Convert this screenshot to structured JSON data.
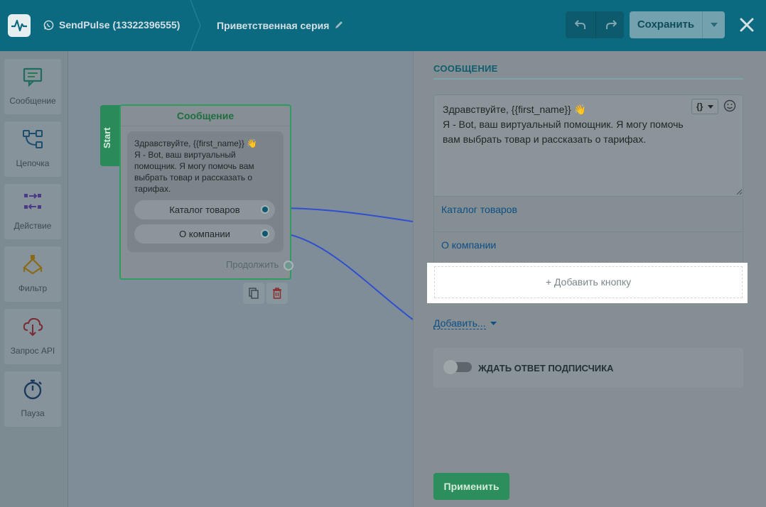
{
  "header": {
    "bot_name": "SendPulse (13322396555)",
    "flow_name": "Приветственная серия",
    "save_label": "Сохранить"
  },
  "toolbar": {
    "items": [
      {
        "label": "Сообщение",
        "icon": "message-icon"
      },
      {
        "label": "Цепочка",
        "icon": "chain-icon"
      },
      {
        "label": "Действие",
        "icon": "action-icon"
      },
      {
        "label": "Фильтр",
        "icon": "filter-icon"
      },
      {
        "label": "Запрос API",
        "icon": "api-request-icon"
      },
      {
        "label": "Пауза",
        "icon": "pause-timer-icon"
      }
    ]
  },
  "node": {
    "start_label": "Start",
    "title": "Сообщение",
    "text": "Здравствуйте,  {{first_name}} 👋\nЯ - Bot, ваш виртуальный помощник. Я могу помочь вам выбрать товар и рассказать о тарифах.",
    "buttons": [
      "Каталог товаров",
      "О компании"
    ],
    "continue_label": "Продолжить"
  },
  "panel": {
    "title": "СООБЩЕНИЕ",
    "message_text": "Здравствуйте,  {{first_name}} 👋\nЯ - Bot, ваш виртуальный  помощник. Я могу помочь вам выбрать товар и рассказать о тарифах.",
    "variable_button": "{}",
    "buttons": [
      "Каталог товаров",
      "О компании"
    ],
    "add_button_label": "+ Добавить кнопку",
    "add_more_label": "Добавить...",
    "wait_reply_label": "ЖДАТЬ ОТВЕТ ПОДПИСЧИКА",
    "wait_reply_enabled": false,
    "apply_label": "Применить"
  },
  "colors": {
    "header": "#0b6a80",
    "accent_green": "#2b8e5c",
    "link_blue": "#0d4f86",
    "wire_blue": "#2f4fd0"
  }
}
